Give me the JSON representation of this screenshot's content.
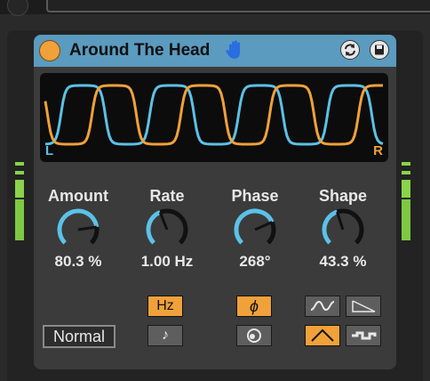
{
  "device": {
    "title": "Around The Head",
    "icons": {
      "power": "power-toggle",
      "hand": "hand-icon",
      "swap": "swap-icon",
      "save": "save-icon"
    },
    "scope": {
      "left_label": "L",
      "right_label": "R"
    },
    "params": [
      {
        "id": "amount",
        "label": "Amount",
        "value": "80.3 %",
        "level": 0.803
      },
      {
        "id": "rate",
        "label": "Rate",
        "value": "1.00 Hz",
        "level": 0.42
      },
      {
        "id": "phase",
        "label": "Phase",
        "value": "268°",
        "level": 0.745
      },
      {
        "id": "shape",
        "label": "Shape",
        "value": "43.3 %",
        "level": 0.433
      }
    ],
    "buttons": {
      "mode": "Normal",
      "hz": "Hz",
      "note": "♪",
      "phase": "ϕ",
      "spin_icon": "spin-icon",
      "wave_sine_icon": "sine-wave-icon",
      "wave_saw_icon": "saw-wave-icon",
      "wave_triangle_icon": "triangle-wave-icon",
      "wave_random_icon": "random-wave-icon"
    }
  },
  "colors": {
    "header": "#5a9bbf",
    "accent_orange": "#f0a13a",
    "accent_blue": "#5cc1e6",
    "meter_green": "#7ec843"
  }
}
